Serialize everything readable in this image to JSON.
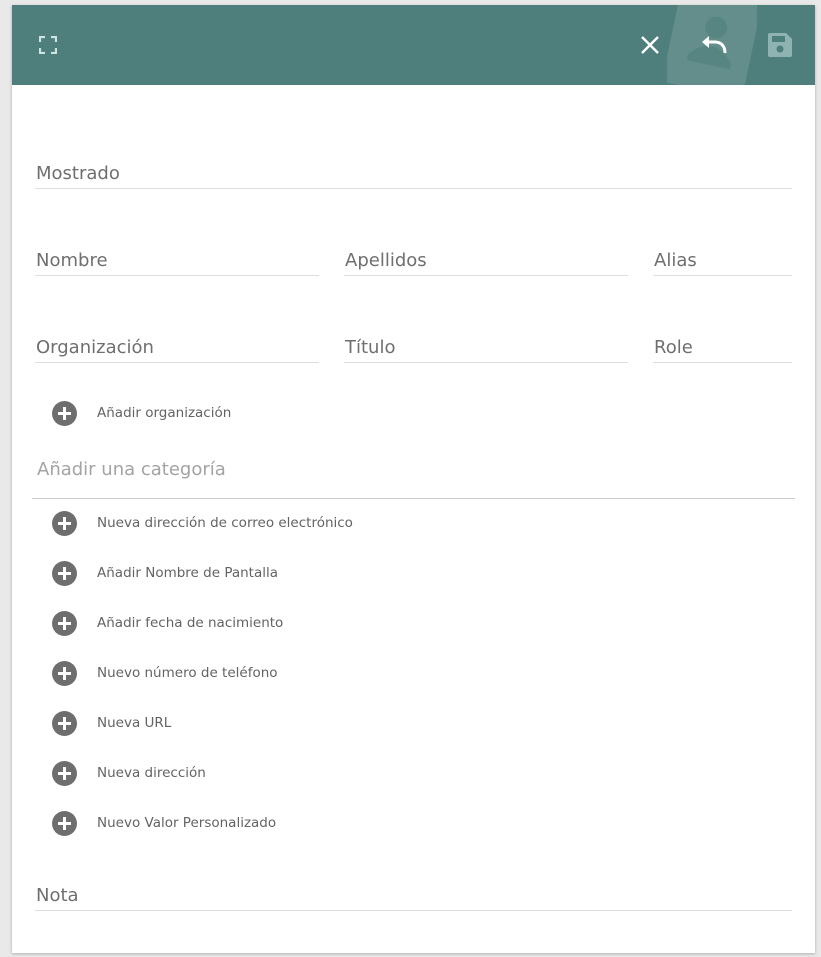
{
  "header": {
    "background_color": "#4e7f7c",
    "icons": {
      "expand": "fullscreen-icon",
      "close": "close-icon",
      "undo": "undo-icon",
      "save": "save-icon",
      "background": "contact-card-icon"
    }
  },
  "fields": {
    "display_name": {
      "placeholder": "Mostrado",
      "value": ""
    },
    "first_name": {
      "placeholder": "Nombre",
      "value": ""
    },
    "last_name": {
      "placeholder": "Apellidos",
      "value": ""
    },
    "alias": {
      "placeholder": "Alias",
      "value": ""
    },
    "organization": {
      "placeholder": "Organización",
      "value": ""
    },
    "title": {
      "placeholder": "Título",
      "value": ""
    },
    "role": {
      "placeholder": "Role",
      "value": ""
    },
    "category": {
      "placeholder": "Añadir una categoría",
      "value": ""
    },
    "note": {
      "placeholder": "Nota",
      "value": ""
    }
  },
  "actions": {
    "add_organization": "Añadir organización",
    "add_email": "Nueva dirección de correo electrónico",
    "add_screen_name": "Añadir Nombre de Pantalla",
    "add_birthday": "Añadir fecha de nacimiento",
    "add_phone": "Nuevo número de teléfono",
    "add_url": "Nueva URL",
    "add_address": "Nueva dirección",
    "add_custom": "Nuevo Valor Personalizado"
  },
  "colors": {
    "header": "#4e7f7c",
    "plus_button": "#6e6e6e",
    "text": "#636363"
  }
}
